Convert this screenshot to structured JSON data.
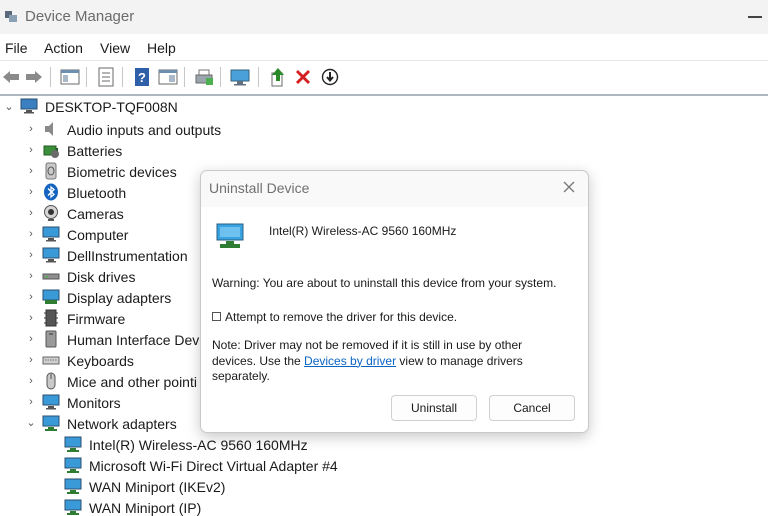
{
  "window": {
    "title": "Device Manager",
    "icon": "device-manager-icon"
  },
  "menu": [
    "File",
    "Action",
    "View",
    "Help"
  ],
  "toolbar": {
    "buttons": [
      "back-icon",
      "forward-icon",
      "properties-pane-icon",
      "properties-icon",
      "help-icon",
      "view-icon",
      "print-icon",
      "scan-hardware-icon",
      "update-driver-icon",
      "uninstall-icon",
      "disable-icon"
    ]
  },
  "tree": {
    "root": "DESKTOP-TQF008N",
    "categories": [
      {
        "label": "Audio inputs and outputs",
        "icon": "speaker-icon"
      },
      {
        "label": "Batteries",
        "icon": "battery-icon"
      },
      {
        "label": "Biometric devices",
        "icon": "biometric-icon"
      },
      {
        "label": "Bluetooth",
        "icon": "bluetooth-icon"
      },
      {
        "label": "Cameras",
        "icon": "camera-icon"
      },
      {
        "label": "Computer",
        "icon": "computer-icon"
      },
      {
        "label": "DellInstrumentation",
        "icon": "monitor-icon"
      },
      {
        "label": "Disk drives",
        "icon": "disk-drive-icon"
      },
      {
        "label": "Display adapters",
        "icon": "display-adapter-icon"
      },
      {
        "label": "Firmware",
        "icon": "firmware-icon"
      },
      {
        "label": "Human Interface Devic",
        "icon": "hid-icon"
      },
      {
        "label": "Keyboards",
        "icon": "keyboard-icon"
      },
      {
        "label": "Mice and other pointi",
        "icon": "mouse-icon"
      },
      {
        "label": "Monitors",
        "icon": "monitor-icon"
      },
      {
        "label": "Network adapters",
        "icon": "network-adapter-icon",
        "expanded": true
      }
    ],
    "network_children": [
      "Intel(R) Wireless-AC 9560 160MHz",
      "Microsoft Wi-Fi Direct Virtual Adapter #4",
      "WAN Miniport (IKEv2)",
      "WAN Miniport (IP)"
    ]
  },
  "dialog": {
    "title": "Uninstall Device",
    "device_name": "Intel(R) Wireless-AC 9560 160MHz",
    "warning": "Warning: You are about to uninstall this device from your system.",
    "checkbox_label": "Attempt to remove the driver for this device.",
    "checkbox_checked": false,
    "note_line1": "Note: Driver may not be removed if it is still in use by other",
    "note_line2_pre": "devices. Use the ",
    "note_link": "Devices by driver",
    "note_line2_post": " view to manage drivers",
    "note_line3": "separately.",
    "uninstall_label": "Uninstall",
    "cancel_label": "Cancel"
  },
  "colors": {
    "link": "#0b63c5",
    "uninstall_red": "#d42020",
    "update_green": "#2a8a2a",
    "network_blue": "#1e88c8"
  }
}
